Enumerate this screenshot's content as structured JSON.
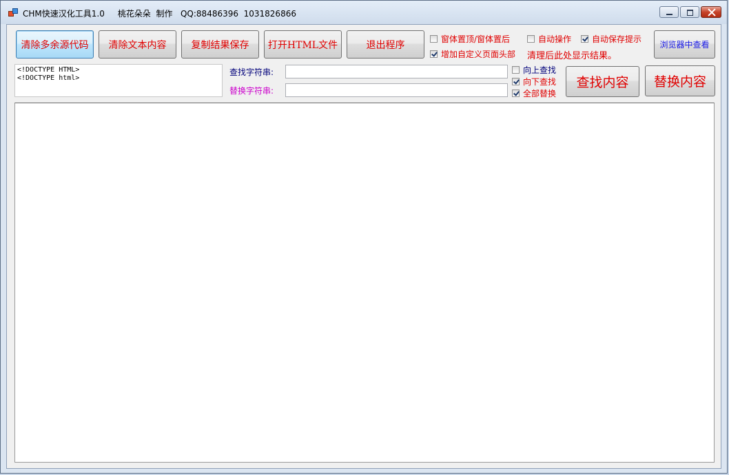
{
  "window": {
    "title": "CHM快速汉化工具1.0     桃花朵朵  制作   QQ:88486396  1031826866"
  },
  "toolbar": {
    "clean_source": "清除多余源代码",
    "clear_text": "清除文本内容",
    "copy_save": "复制结果保存",
    "open_html": "打开HTML文件",
    "exit": "退出程序",
    "view_browser": "浏览器中查看"
  },
  "options": {
    "topmost": {
      "label": "窗体置顶/窗体置后",
      "checked": false
    },
    "custom_header": {
      "label": "增加自定义页面头部",
      "checked": true
    },
    "auto_operate": {
      "label": "自动操作",
      "checked": false
    },
    "auto_save_prompt": {
      "label": "自动保存提示",
      "checked": true
    },
    "note": "清理后此处显示结果。"
  },
  "search": {
    "find_label": "查找字符串:",
    "replace_label": "替换字符串:",
    "find_value": "",
    "replace_value": "",
    "search_up": {
      "label": "向上查找",
      "checked": false
    },
    "search_down": {
      "label": "向下查找",
      "checked": true
    },
    "replace_all": {
      "label": "全部替换",
      "checked": true
    },
    "find_button": "查找内容",
    "replace_button": "替换内容"
  },
  "source_text": {
    "line1": "<!DOCTYPE HTML>",
    "line2": "<!DOCTYPE html>"
  },
  "result_text": "",
  "colors": {
    "button_text": "#e00000",
    "browser_button_text": "#1a1ae6",
    "find_label": "#00007a",
    "replace_label": "#cc00cc"
  }
}
